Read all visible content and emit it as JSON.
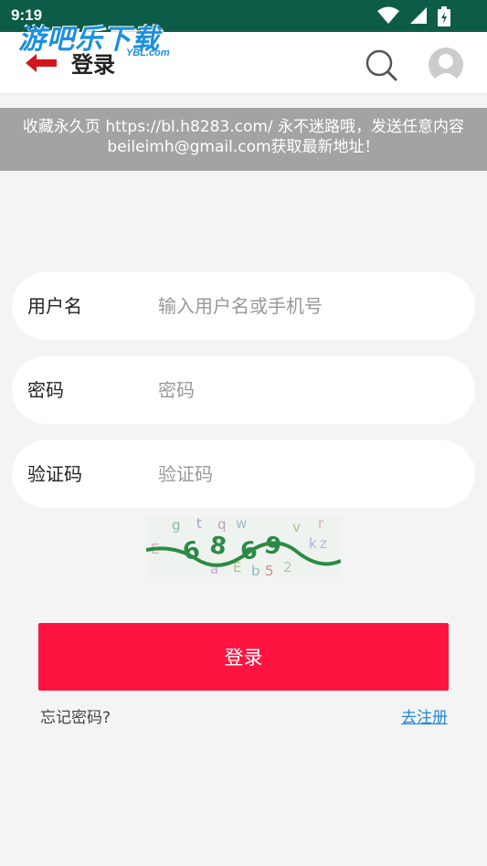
{
  "status_bar": {
    "time": "9:19",
    "icons": [
      "wifi-icon",
      "cell-signal-icon",
      "battery-charging-icon"
    ]
  },
  "watermark": {
    "text": "游吧乐下载",
    "sub": "YBL.com"
  },
  "header": {
    "title": "登录",
    "back_icon": "arrow-left-icon",
    "search_icon": "search-icon",
    "avatar_icon": "user-avatar-icon"
  },
  "notice": {
    "text": "收藏永久页 https://bl.h8283.com/ 永不迷路哦，发送任意内容beileimh@gmail.com获取最新地址！"
  },
  "form": {
    "username": {
      "label": "用户名",
      "placeholder": "输入用户名或手机号",
      "value": ""
    },
    "password": {
      "label": "密码",
      "placeholder": "密码",
      "value": ""
    },
    "captcha": {
      "label": "验证码",
      "placeholder": "验证码",
      "value": ""
    }
  },
  "captcha_image": {
    "text": "6869",
    "noise": "gtqwvkzE52Eabw"
  },
  "actions": {
    "login_label": "登录",
    "forgot_label": "忘记密码?",
    "register_label": "去注册"
  },
  "colors": {
    "status_bar": "#0d5c48",
    "accent": "#fe1440",
    "link": "#1f88d9",
    "back_arrow": "#d0161c",
    "notice_bg": "#a3a3a3"
  }
}
